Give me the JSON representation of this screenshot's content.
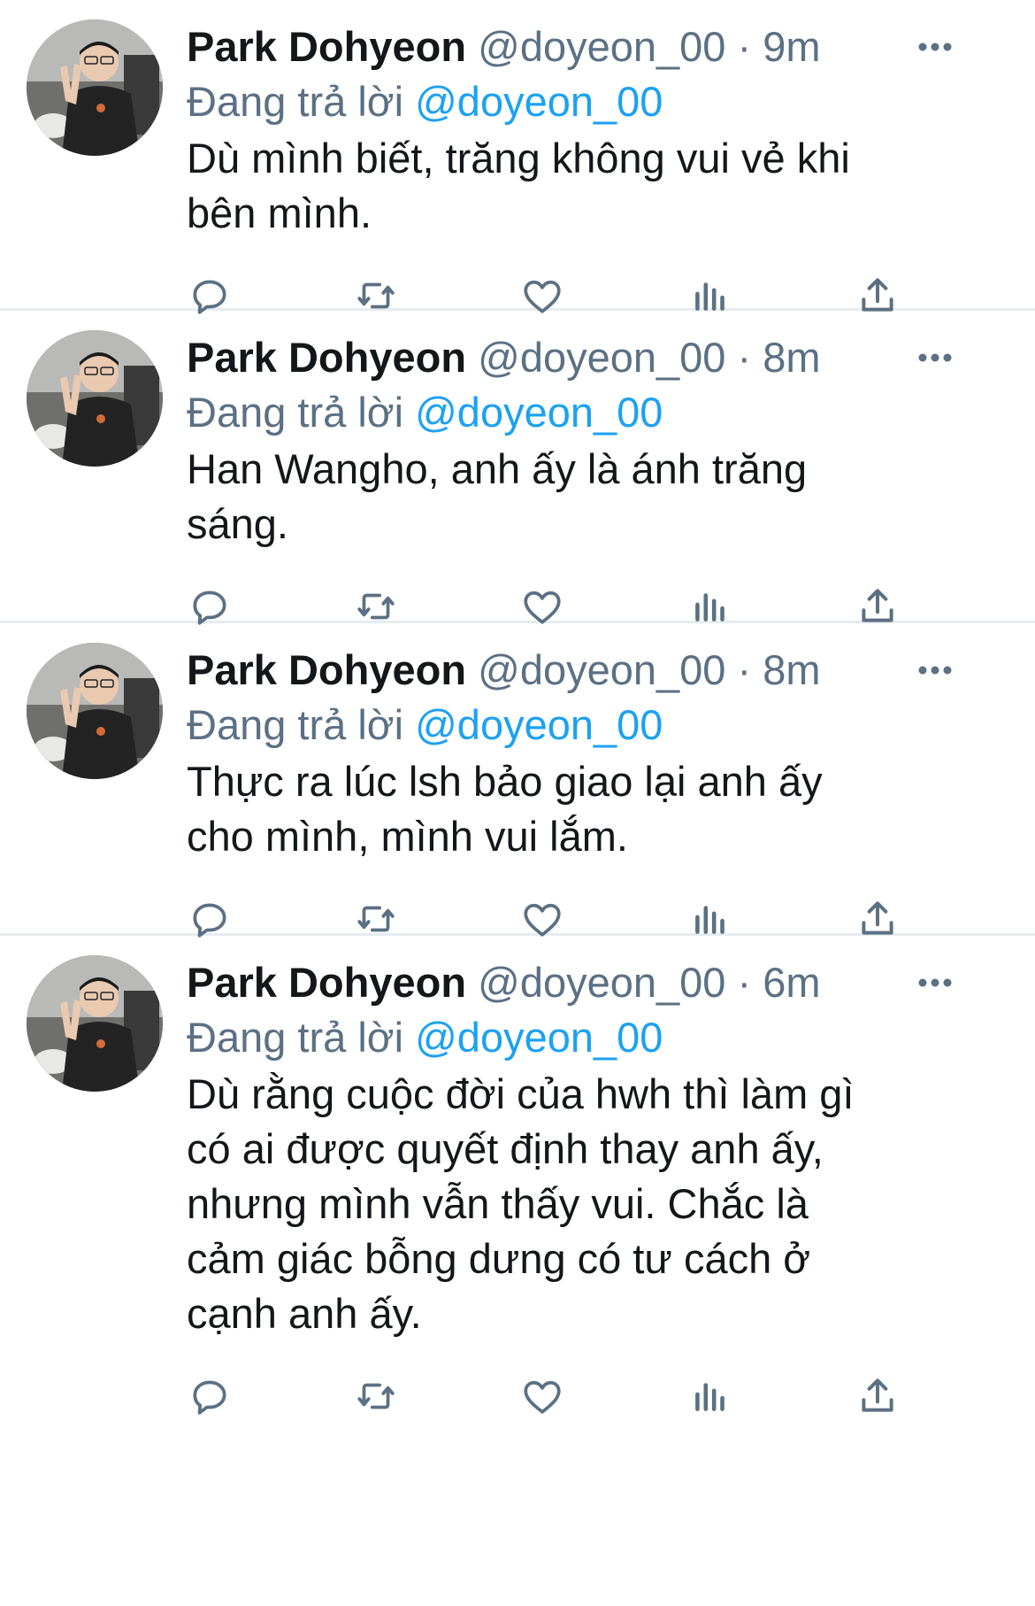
{
  "colors": {
    "text": "#14171a",
    "secondary": "#5b7083",
    "accent": "#1da1f2",
    "divider": "#e6ecf0"
  },
  "tweets": [
    {
      "display_name": "Park Dohyeon",
      "handle": "@doyeon_00",
      "separator": "·",
      "time": "9m",
      "reply_prefix": "Đang trả lời",
      "reply_to": "@doyeon_00",
      "text": "Dù mình biết, trăng không vui vẻ khi\nbên mình."
    },
    {
      "display_name": "Park Dohyeon",
      "handle": "@doyeon_00",
      "separator": "·",
      "time": "8m",
      "reply_prefix": "Đang trả lời",
      "reply_to": "@doyeon_00",
      "text": "Han Wangho, anh ấy là ánh trăng\nsáng."
    },
    {
      "display_name": "Park Dohyeon",
      "handle": "@doyeon_00",
      "separator": "·",
      "time": "8m",
      "reply_prefix": "Đang trả lời",
      "reply_to": "@doyeon_00",
      "text": "Thực ra lúc lsh bảo giao lại anh ấy\ncho mình, mình vui lắm."
    },
    {
      "display_name": "Park Dohyeon",
      "handle": "@doyeon_00",
      "separator": "·",
      "time": "6m",
      "reply_prefix": "Đang trả lời",
      "reply_to": "@doyeon_00",
      "text": "Dù rằng cuộc đời của hwh thì làm gì\ncó ai được quyết định thay anh ấy,\nnhưng mình vẫn thấy vui. Chắc là\ncảm giác bỗng dưng có tư cách ở\ncạnh anh ấy."
    }
  ],
  "icons": {
    "more": "more-horizontal-icon",
    "reply": "reply-bubble-icon",
    "retweet": "retweet-icon",
    "like": "heart-icon",
    "stats": "analytics-bars-icon",
    "share": "share-upload-icon"
  }
}
